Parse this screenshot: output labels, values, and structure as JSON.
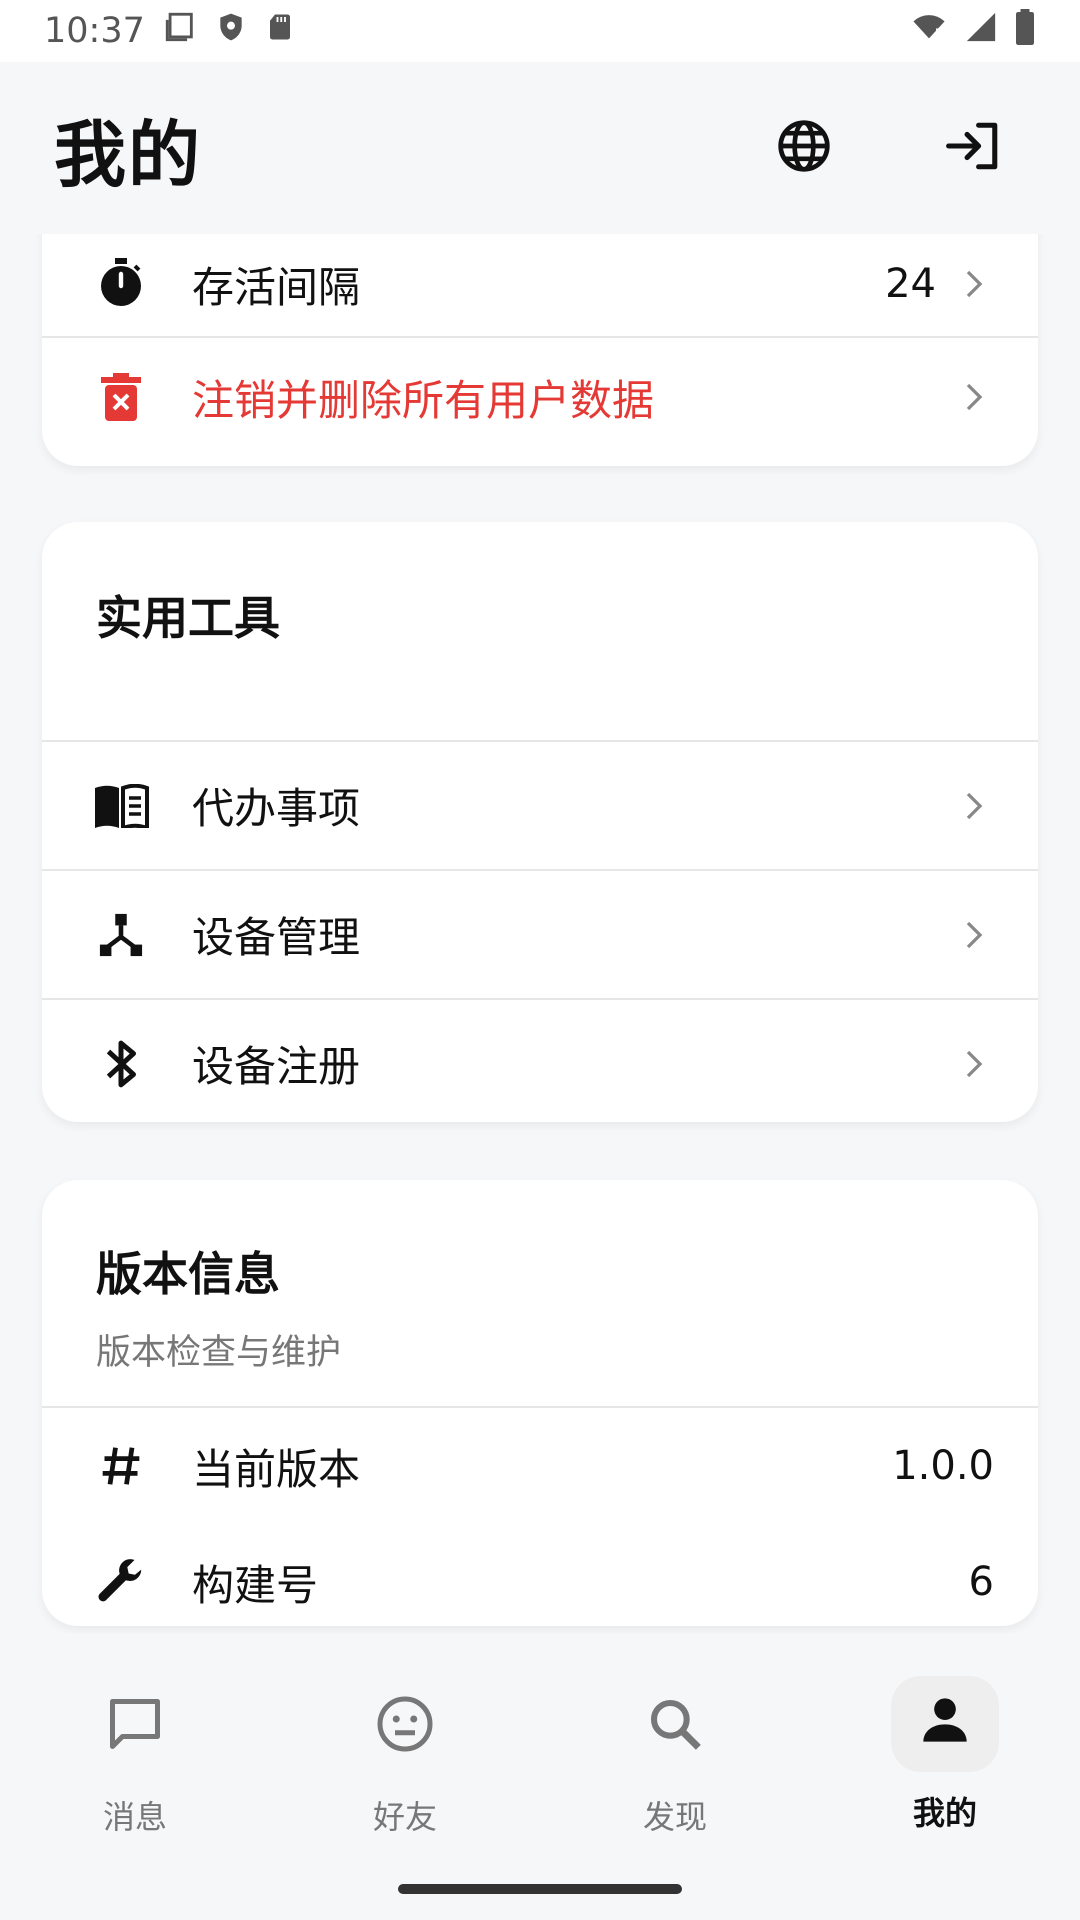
{
  "status_bar": {
    "time": "10:37",
    "icons_left": [
      "screenshot-icon",
      "shield-icon",
      "sd-card-icon"
    ],
    "icons_right": [
      "wifi-icon",
      "signal-icon",
      "battery-icon"
    ]
  },
  "appbar": {
    "title": "我的",
    "actions": [
      "globe-icon",
      "login-icon"
    ]
  },
  "account_card": {
    "rows": [
      {
        "icon": "timer-icon",
        "label": "存活间隔",
        "value": "24"
      },
      {
        "icon": "delete-icon",
        "label": "注销并删除所有用户数据",
        "danger": true
      }
    ]
  },
  "tools_card": {
    "title": "实用工具",
    "rows": [
      {
        "icon": "book-icon",
        "label": "代办事项"
      },
      {
        "icon": "device-hub-icon",
        "label": "设备管理"
      },
      {
        "icon": "bluetooth-icon",
        "label": "设备注册"
      }
    ]
  },
  "version_card": {
    "title": "版本信息",
    "subtitle": "版本检查与维护",
    "rows": [
      {
        "icon": "hash-icon",
        "label": "当前版本",
        "value": "1.0.0"
      },
      {
        "icon": "wrench-icon",
        "label": "构建号",
        "value": "6"
      }
    ]
  },
  "bottom_nav": [
    {
      "icon": "chat-icon",
      "label": "消息",
      "active": false
    },
    {
      "icon": "smiley-icon",
      "label": "好友",
      "active": false
    },
    {
      "icon": "search-icon",
      "label": "发现",
      "active": false
    },
    {
      "icon": "person-icon",
      "label": "我的",
      "active": true
    }
  ],
  "colors": {
    "danger": "#e53935",
    "background": "#f6f7f9",
    "card": "#ffffff",
    "text": "#111111",
    "muted": "#777777"
  }
}
